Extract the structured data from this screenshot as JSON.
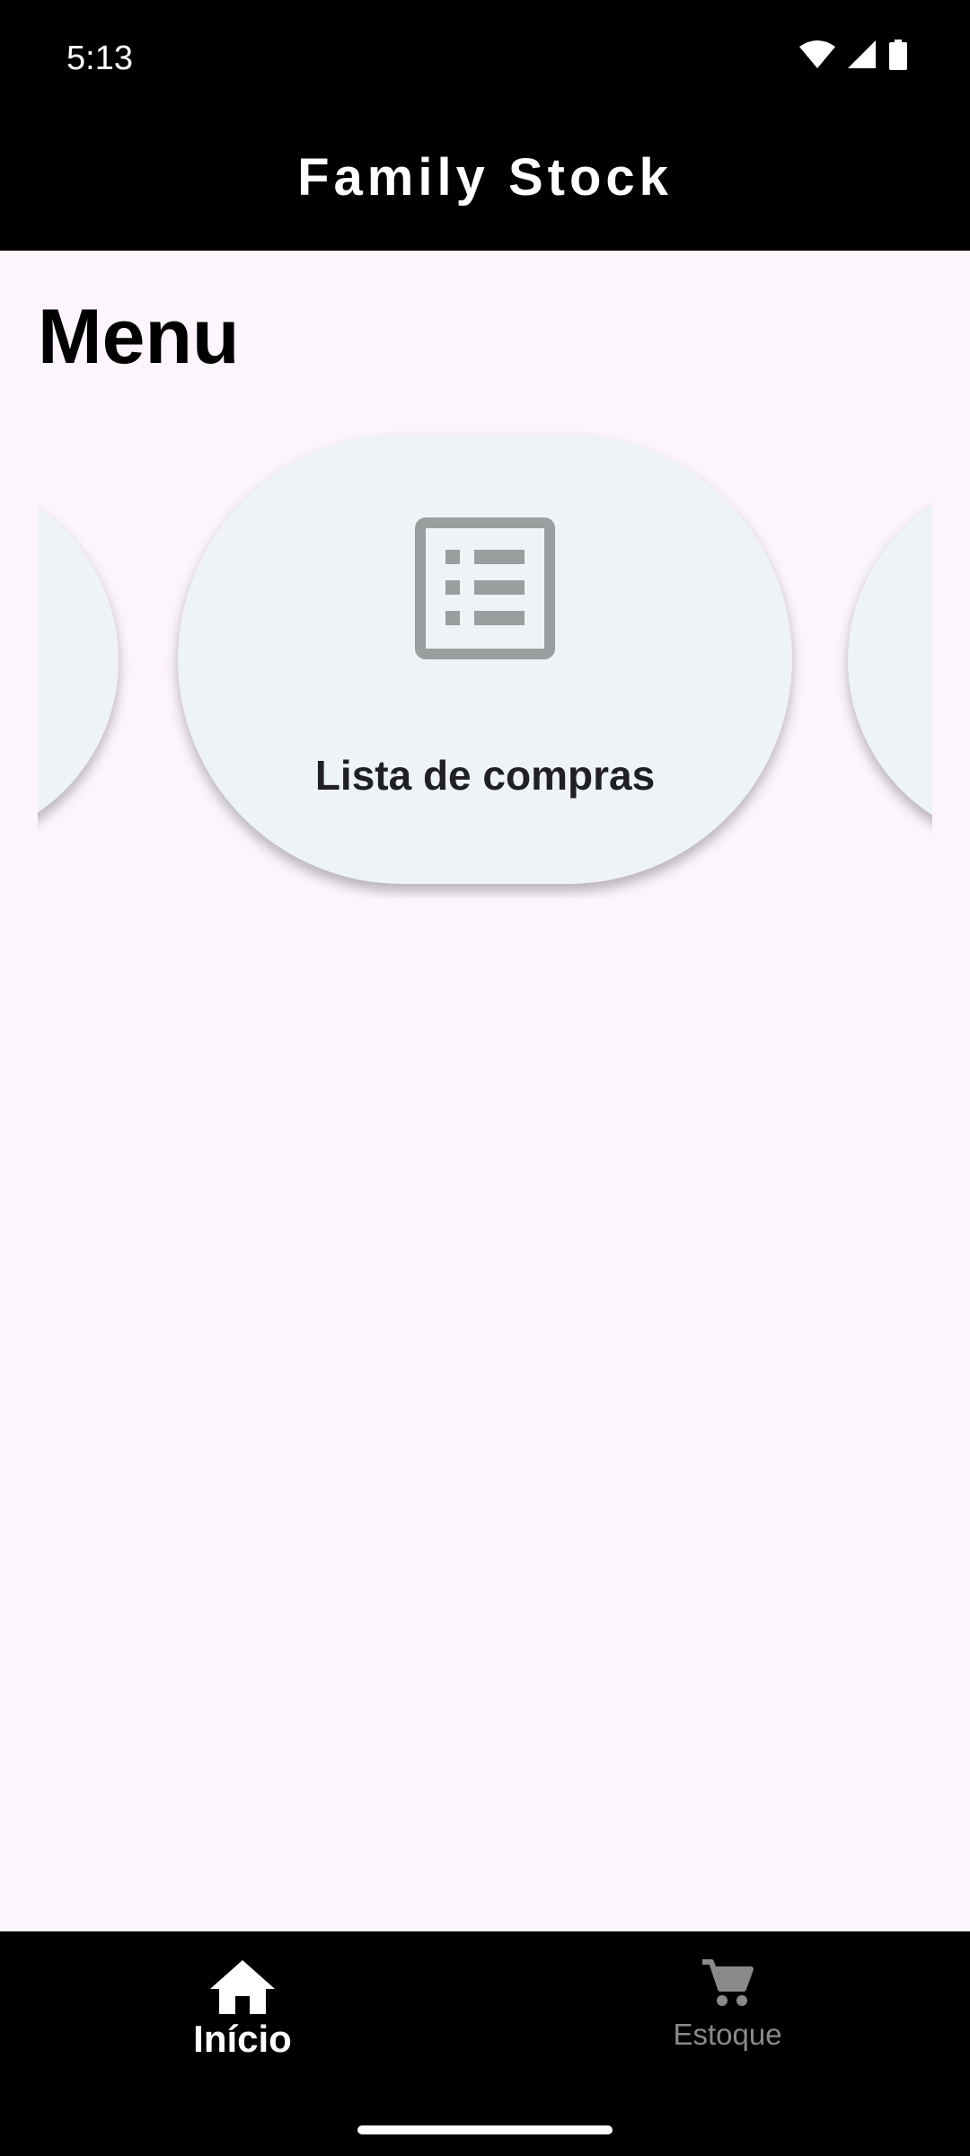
{
  "status_bar": {
    "time": "5:13",
    "icons": [
      "wifi-icon",
      "signal-icon",
      "battery-icon"
    ]
  },
  "app_bar": {
    "title": "Family Stock"
  },
  "main": {
    "heading": "Menu",
    "carousel": {
      "center_card": {
        "icon": "list-icon",
        "label": "Lista de compras"
      }
    }
  },
  "bottom_nav": {
    "items": [
      {
        "icon": "home-icon",
        "label": "Início",
        "active": true
      },
      {
        "icon": "cart-icon",
        "label": "Estoque",
        "active": false
      }
    ]
  },
  "colors": {
    "background": "#fcf5fc",
    "bars": "#000000",
    "card": "#eef3f6",
    "icon_gray": "#9a9e9f",
    "inactive_nav": "#8a8a8a"
  }
}
